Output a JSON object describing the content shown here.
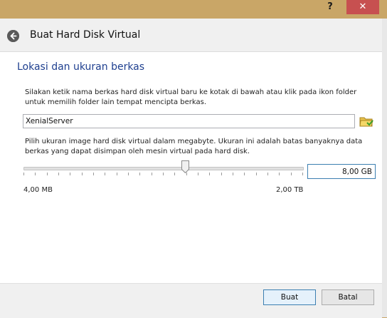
{
  "window": {
    "help_label": "?",
    "close_label": "✕",
    "dialog_title": "Buat Hard Disk Virtual"
  },
  "section": {
    "title": "Lokasi dan ukuran berkas",
    "description1": "Silakan ketik nama berkas hard disk virtual baru ke kotak di bawah atau klik pada ikon folder untuk memilih folder lain tempat mencipta berkas.",
    "file_name_value": "XenialServer",
    "description2": "Pilih ukuran image hard disk virtual dalam megabyte. Ukuran ini adalah batas banyaknya data berkas yang dapat disimpan oleh mesin virtual pada hard disk."
  },
  "size_slider": {
    "min_label": "4,00 MB",
    "max_label": "2,00 TB",
    "position_fraction": 0.58
  },
  "size_input": {
    "value": "8,00 GB"
  },
  "footer": {
    "create_label": "Buat",
    "cancel_label": "Batal"
  },
  "colors": {
    "frame": "#c9a667",
    "accent_title": "#1e3f8f",
    "close_red": "#c75050"
  },
  "icons": {
    "back": "back-arrow-icon",
    "folder": "folder-icon"
  }
}
